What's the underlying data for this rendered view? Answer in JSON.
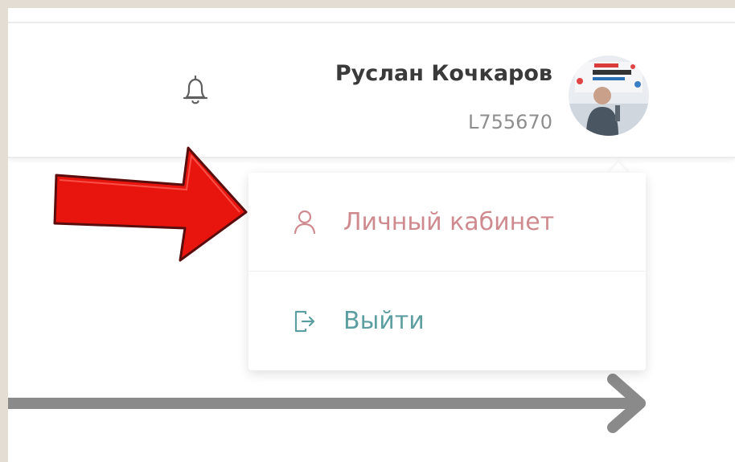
{
  "header": {
    "notifications_icon": "bell-icon",
    "user": {
      "name": "Руслан Кочкаров",
      "id": "L755670",
      "avatar_icon": "user-avatar"
    }
  },
  "user_menu": {
    "items": [
      {
        "label": "Личный кабинет",
        "icon": "user-icon",
        "color": "#cf8a8f"
      },
      {
        "label": "Выйти",
        "icon": "logout-icon",
        "color": "#5d9fa1"
      }
    ]
  },
  "annotations": {
    "highlight_arrow_color": "#e8150f",
    "connector_arrow_color": "#8a8a8a"
  }
}
